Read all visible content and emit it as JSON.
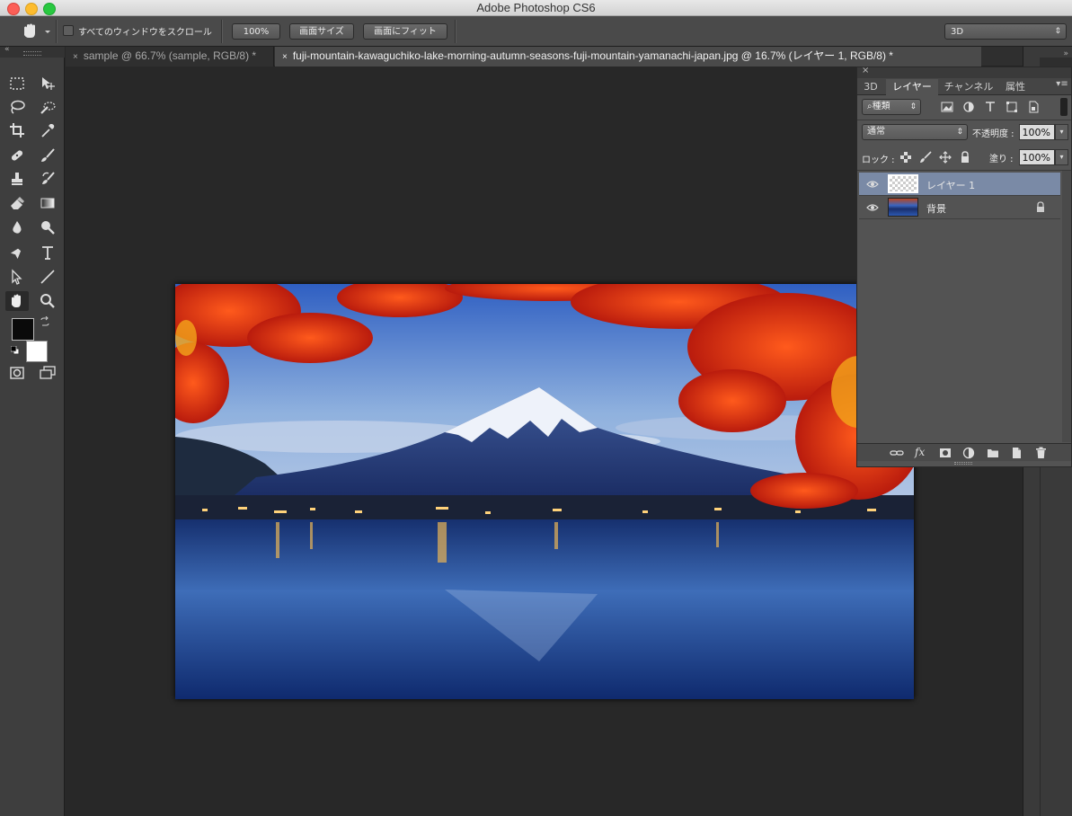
{
  "window": {
    "title": "Adobe Photoshop CS6"
  },
  "colors": {
    "accent": "#6b7f9e",
    "selected_layer": "#7a8aa6"
  },
  "options_bar": {
    "scroll_all_label": "すべてのウィンドウをスクロール",
    "zoom_100": "100%",
    "fit_screen_size": "画面サイズ",
    "fit_screen": "画面にフィット",
    "workspace": "3D"
  },
  "tabs": [
    {
      "label": "sample @ 66.7% (sample, RGB/8) *",
      "active": false
    },
    {
      "label": "fuji-mountain-kawaguchiko-lake-morning-autumn-seasons-fuji-mountain-yamanachi-japan.jpg @ 16.7% (レイヤー 1, RGB/8) *",
      "active": true
    }
  ],
  "layers_panel": {
    "tabs": [
      "3D",
      "レイヤー",
      "チャンネル",
      "属性"
    ],
    "filter_kind": "種類",
    "blend_mode": "通常",
    "opacity_label": "不透明度 :",
    "opacity_value": "100%",
    "lock_label": "ロック :",
    "fill_label": "塗り :",
    "fill_value": "100%",
    "layers": [
      {
        "name": "レイヤー 1",
        "selected": true,
        "visible": true,
        "locked": false
      },
      {
        "name": "背景",
        "selected": false,
        "visible": true,
        "locked": true
      }
    ]
  }
}
